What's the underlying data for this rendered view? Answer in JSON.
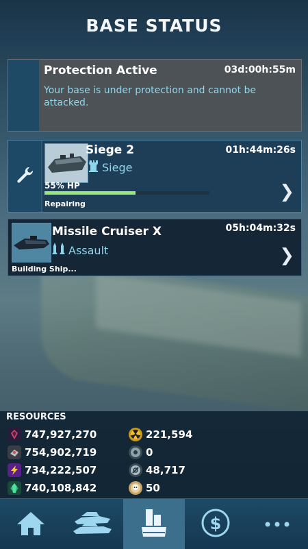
{
  "header": {
    "title": "BASE STATUS"
  },
  "protection": {
    "title": "Protection Active",
    "timer": "03d:00h:55m",
    "description": "Your base is under protection and cannot be attacked."
  },
  "queue": [
    {
      "name": "Siege 2",
      "timer": "01h:44m:26s",
      "class": "Siege",
      "hp_label": "55% HP",
      "hp_percent": 55,
      "status": "Repairing",
      "icon": "wrench-icon"
    },
    {
      "name": "Missile Cruiser X",
      "timer": "05h:04m:32s",
      "class": "Assault",
      "status": "Building Ship..."
    }
  ],
  "resources": {
    "title": "RESOURCES",
    "items": [
      {
        "icon": "dark-crystal-icon",
        "value": "747,927,270"
      },
      {
        "icon": "metal-icon",
        "value": "754,902,719"
      },
      {
        "icon": "energy-icon",
        "value": "734,222,507"
      },
      {
        "icon": "green-crystal-icon",
        "value": "740,108,842"
      },
      {
        "icon": "radiation-icon",
        "value": "221,594"
      },
      {
        "icon": "gear-token-icon",
        "value": "0"
      },
      {
        "icon": "blueprint-token-icon",
        "value": "48,717"
      },
      {
        "icon": "skull-token-icon",
        "value": "50"
      }
    ]
  },
  "nav": {
    "items": [
      "home-icon",
      "fleet-icon",
      "base-icon",
      "shop-icon",
      "more-icon"
    ],
    "active": 2
  },
  "colors": {
    "header_bg": "#1a3346",
    "accent_cyan": "#8fd6ec",
    "hp_green": "#9be87a",
    "nav_active": "#3c6f8c"
  }
}
